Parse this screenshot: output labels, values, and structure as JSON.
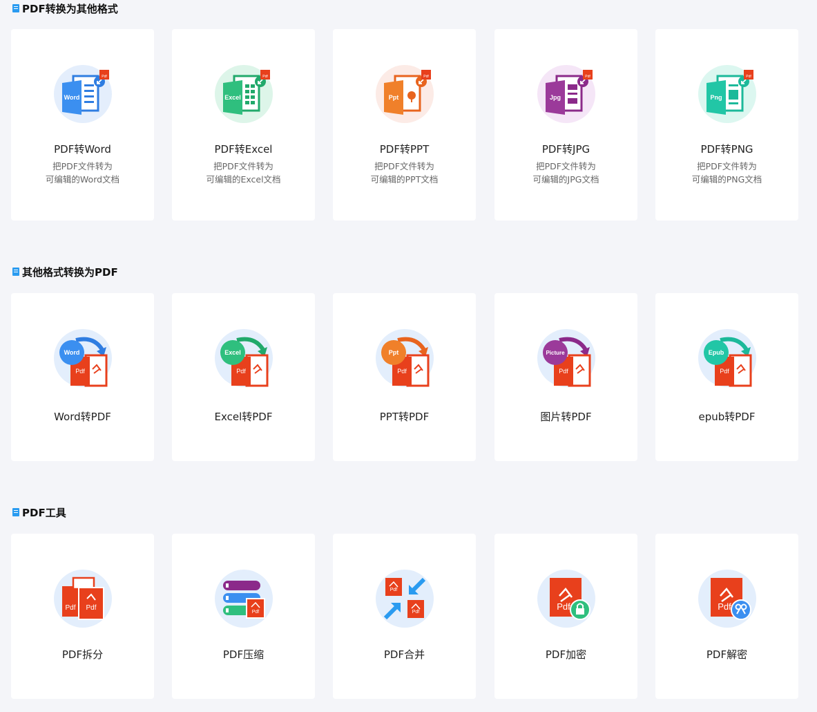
{
  "sections": [
    {
      "title": "PDF转换为其他格式",
      "cards": [
        {
          "name": "PDF转Word",
          "desc1": "把PDF文件转为",
          "desc2": "可编辑的Word文档",
          "badge": "Word",
          "color": "#2f7de1",
          "circle": "#e4eefc"
        },
        {
          "name": "PDF转Excel",
          "desc1": "把PDF文件转为",
          "desc2": "可编辑的Excel文档",
          "badge": "Excel",
          "color": "#21a96b",
          "circle": "#ddf5e9"
        },
        {
          "name": "PDF转PPT",
          "desc1": "把PDF文件转为",
          "desc2": "可编辑的PPT文档",
          "badge": "Ppt",
          "color": "#e8641e",
          "circle": "#fcebe6"
        },
        {
          "name": "PDF转JPG",
          "desc1": "把PDF文件转为",
          "desc2": "可编辑的JPG文档",
          "badge": "Jpg",
          "color": "#8b2a8a",
          "circle": "#f5e6f7"
        },
        {
          "name": "PDF转PNG",
          "desc1": "把PDF文件转为",
          "desc2": "可编辑的PNG文档",
          "badge": "Png",
          "color": "#1cb99a",
          "circle": "#dcf7f0"
        }
      ]
    },
    {
      "title": "其他格式转换为PDF",
      "cards": [
        {
          "name": "Word转PDF",
          "badge": "Word",
          "color": "#2f7de1"
        },
        {
          "name": "Excel转PDF",
          "badge": "Excel",
          "color": "#21a96b"
        },
        {
          "name": "PPT转PDF",
          "badge": "Ppt",
          "color": "#e8641e"
        },
        {
          "name": "图片转PDF",
          "badge": "Picture",
          "color": "#8b2a8a"
        },
        {
          "name": "epub转PDF",
          "badge": "Epub",
          "color": "#1cb99a"
        }
      ]
    },
    {
      "title": "PDF工具",
      "cards": [
        {
          "name": "PDF拆分",
          "tool": "split"
        },
        {
          "name": "PDF压缩",
          "tool": "compress"
        },
        {
          "name": "PDF合并",
          "tool": "merge"
        },
        {
          "name": "PDF加密",
          "tool": "encrypt"
        },
        {
          "name": "PDF解密",
          "tool": "decrypt"
        }
      ]
    }
  ],
  "pdf_label": "Pdf",
  "colors": {
    "pdf_red": "#e8401c",
    "circle_blue": "#e3eefc",
    "background": "#f4f5f9"
  }
}
